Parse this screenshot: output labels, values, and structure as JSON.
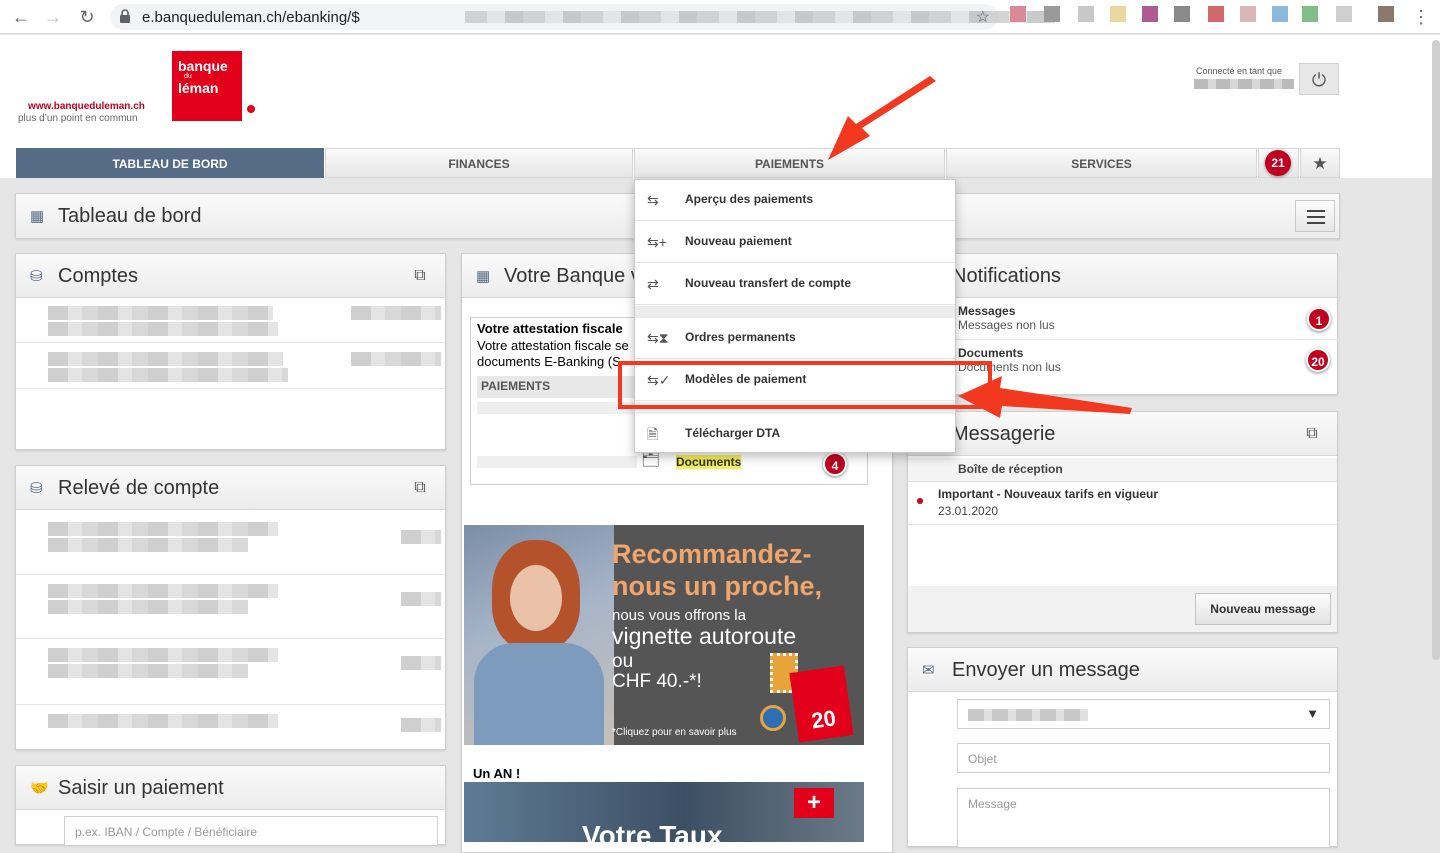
{
  "browser": {
    "url": "e.banqueduleman.ch/ebanking/$"
  },
  "header": {
    "brand_url": "www.banqueduleman.ch",
    "brand_tagline": "plus d’un point en commun",
    "logo_line1": "banque",
    "logo_line2": "du",
    "logo_line3": "léman",
    "connected_label": "Connecté en tant que"
  },
  "tabs": [
    {
      "label": "TABLEAU DE BORD",
      "active": true
    },
    {
      "label": "FINANCES",
      "active": false
    },
    {
      "label": "PAIEMENTS",
      "active": false
    },
    {
      "label": "SERVICES",
      "active": false
    }
  ],
  "tab_badge_count": "21",
  "dashboard": {
    "title": "Tableau de bord"
  },
  "comptes": {
    "title": "Comptes"
  },
  "releve": {
    "title": "Relevé de compte"
  },
  "saisir": {
    "title": "Saisir un paiement",
    "placeholder": "p.ex. IBAN / Compte / Bénéficiaire"
  },
  "banque": {
    "title": "Votre Banque v",
    "attestation_title": "Votre attestation fiscale",
    "attestation_line1": "Votre attestation fiscale se",
    "attestation_line2": "documents E-Banking (S",
    "col_header": "PAIEMENTS",
    "documents_label": "Documents",
    "documents_count": "4",
    "un_an": "Un AN !"
  },
  "banner": {
    "line1": "Recommandez-",
    "line2": "nous un proche,",
    "line3": "nous vous offrons la",
    "line4": "vignette autoroute",
    "line5": "ou",
    "line6": "CHF 40.-*!",
    "footnote": "*Cliquez pour en savoir plus",
    "badge": "20"
  },
  "banner2": {
    "text": "Votre Taux"
  },
  "notifications": {
    "title": "Notifications",
    "items": [
      {
        "title": "Messages",
        "sub": "Messages non lus",
        "count": "1"
      },
      {
        "title": "Documents",
        "sub": "Documents non lus",
        "count": "20"
      }
    ]
  },
  "messagerie": {
    "title": "Messagerie",
    "inbox_label": "Boîte de réception",
    "message_title": "Important - Nouveaux tarifs en vigueur",
    "message_date": "23.01.2020",
    "new_message_button": "Nouveau message"
  },
  "envoyer": {
    "title": "Envoyer un message",
    "subject_placeholder": "Objet",
    "message_placeholder": "Message"
  },
  "paiements_menu": [
    {
      "label": "Aperçu des paiements",
      "icon": "handshake-icon"
    },
    {
      "label": "Nouveau paiement",
      "icon": "handshake-plus-icon"
    },
    {
      "label": "Nouveau transfert de compte",
      "icon": "transfer-icon"
    },
    {
      "label": "Ordres permanents",
      "icon": "handshake-hourglass-icon"
    },
    {
      "label": "Modèles de paiement",
      "icon": "handshake-template-icon"
    },
    {
      "label": "Télécharger DTA",
      "icon": "file-download-icon"
    }
  ],
  "colors": {
    "brand_red": "#e2001a",
    "tab_active": "#566b86",
    "badge_red": "#c1001f",
    "annotation": "#f2391f",
    "banner_orange": "#f0a56b"
  }
}
